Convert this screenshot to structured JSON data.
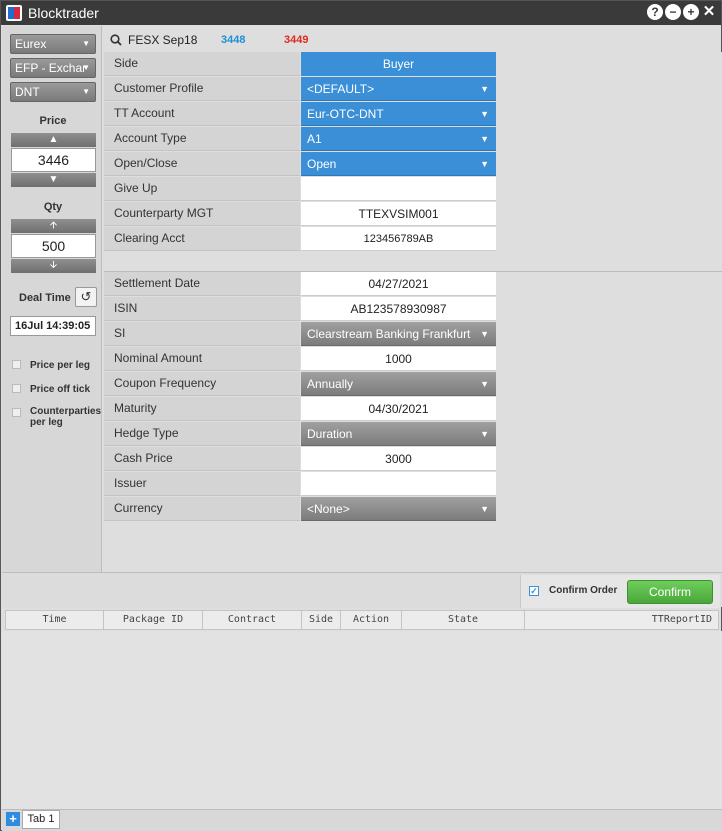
{
  "app": {
    "title": "Blocktrader"
  },
  "titlebar_icons": [
    "help-icon",
    "minimize-icon",
    "add-icon",
    "close-icon"
  ],
  "left": {
    "exchange": "Eurex",
    "trade_type": "EFP - Exchar",
    "account": "DNT",
    "price_label": "Price",
    "price_value": "3446",
    "qty_label": "Qty",
    "qty_value": "500",
    "deal_time_label": "Deal Time",
    "deal_time_value": "16Jul 14:39:05",
    "checkboxes": [
      {
        "label": "Price per leg",
        "checked": false
      },
      {
        "label": "Price off tick",
        "checked": false
      },
      {
        "label": "Counterparties per leg",
        "checked": false
      }
    ]
  },
  "instrument": {
    "name": "FESX Sep18",
    "bid": "3448",
    "ask": "3449"
  },
  "form": {
    "side": {
      "label": "Side",
      "value": "Buyer"
    },
    "customer_profile": {
      "label": "Customer Profile",
      "value": "<DEFAULT>"
    },
    "tt_account": {
      "label": "TT Account",
      "value": "Eur-OTC-DNT"
    },
    "account_type": {
      "label": "Account Type",
      "value": "A1"
    },
    "open_close": {
      "label": "Open/Close",
      "value": "Open"
    },
    "give_up": {
      "label": "Give Up",
      "value": ""
    },
    "counterparty_mgt": {
      "label": "Counterparty MGT",
      "value": "TTEXVSIM001"
    },
    "clearing_acct": {
      "label": "Clearing Acct",
      "value": "123456789AB"
    },
    "settlement_date": {
      "label": "Settlement Date",
      "value": "04/27/2021"
    },
    "isin": {
      "label": "ISIN",
      "value": "AB123578930987"
    },
    "si": {
      "label": "SI",
      "value": "Clearstream Banking Frankfurt"
    },
    "nominal_amount": {
      "label": "Nominal Amount",
      "value": "1000"
    },
    "coupon_frequency": {
      "label": "Coupon Frequency",
      "value": "Annually"
    },
    "maturity": {
      "label": "Maturity",
      "value": "04/30/2021"
    },
    "hedge_type": {
      "label": "Hedge Type",
      "value": "Duration"
    },
    "cash_price": {
      "label": "Cash Price",
      "value": "3000"
    },
    "issuer": {
      "label": "Issuer",
      "value": ""
    },
    "currency": {
      "label": "Currency",
      "value": "<None>"
    }
  },
  "confirm": {
    "checkbox_label": "Confirm Order",
    "checked": true,
    "button_label": "Confirm"
  },
  "grid": {
    "columns": [
      "Time",
      "Package ID",
      "Contract",
      "Side",
      "Action",
      "State",
      "TTReportID"
    ]
  },
  "tabs": {
    "add_label": "+",
    "items": [
      "Tab 1"
    ]
  },
  "colors": {
    "accent_blue": "#3a8fd7",
    "bid": "#1e8fd6",
    "ask": "#e0291f",
    "confirm_green": "#4aa83b"
  }
}
